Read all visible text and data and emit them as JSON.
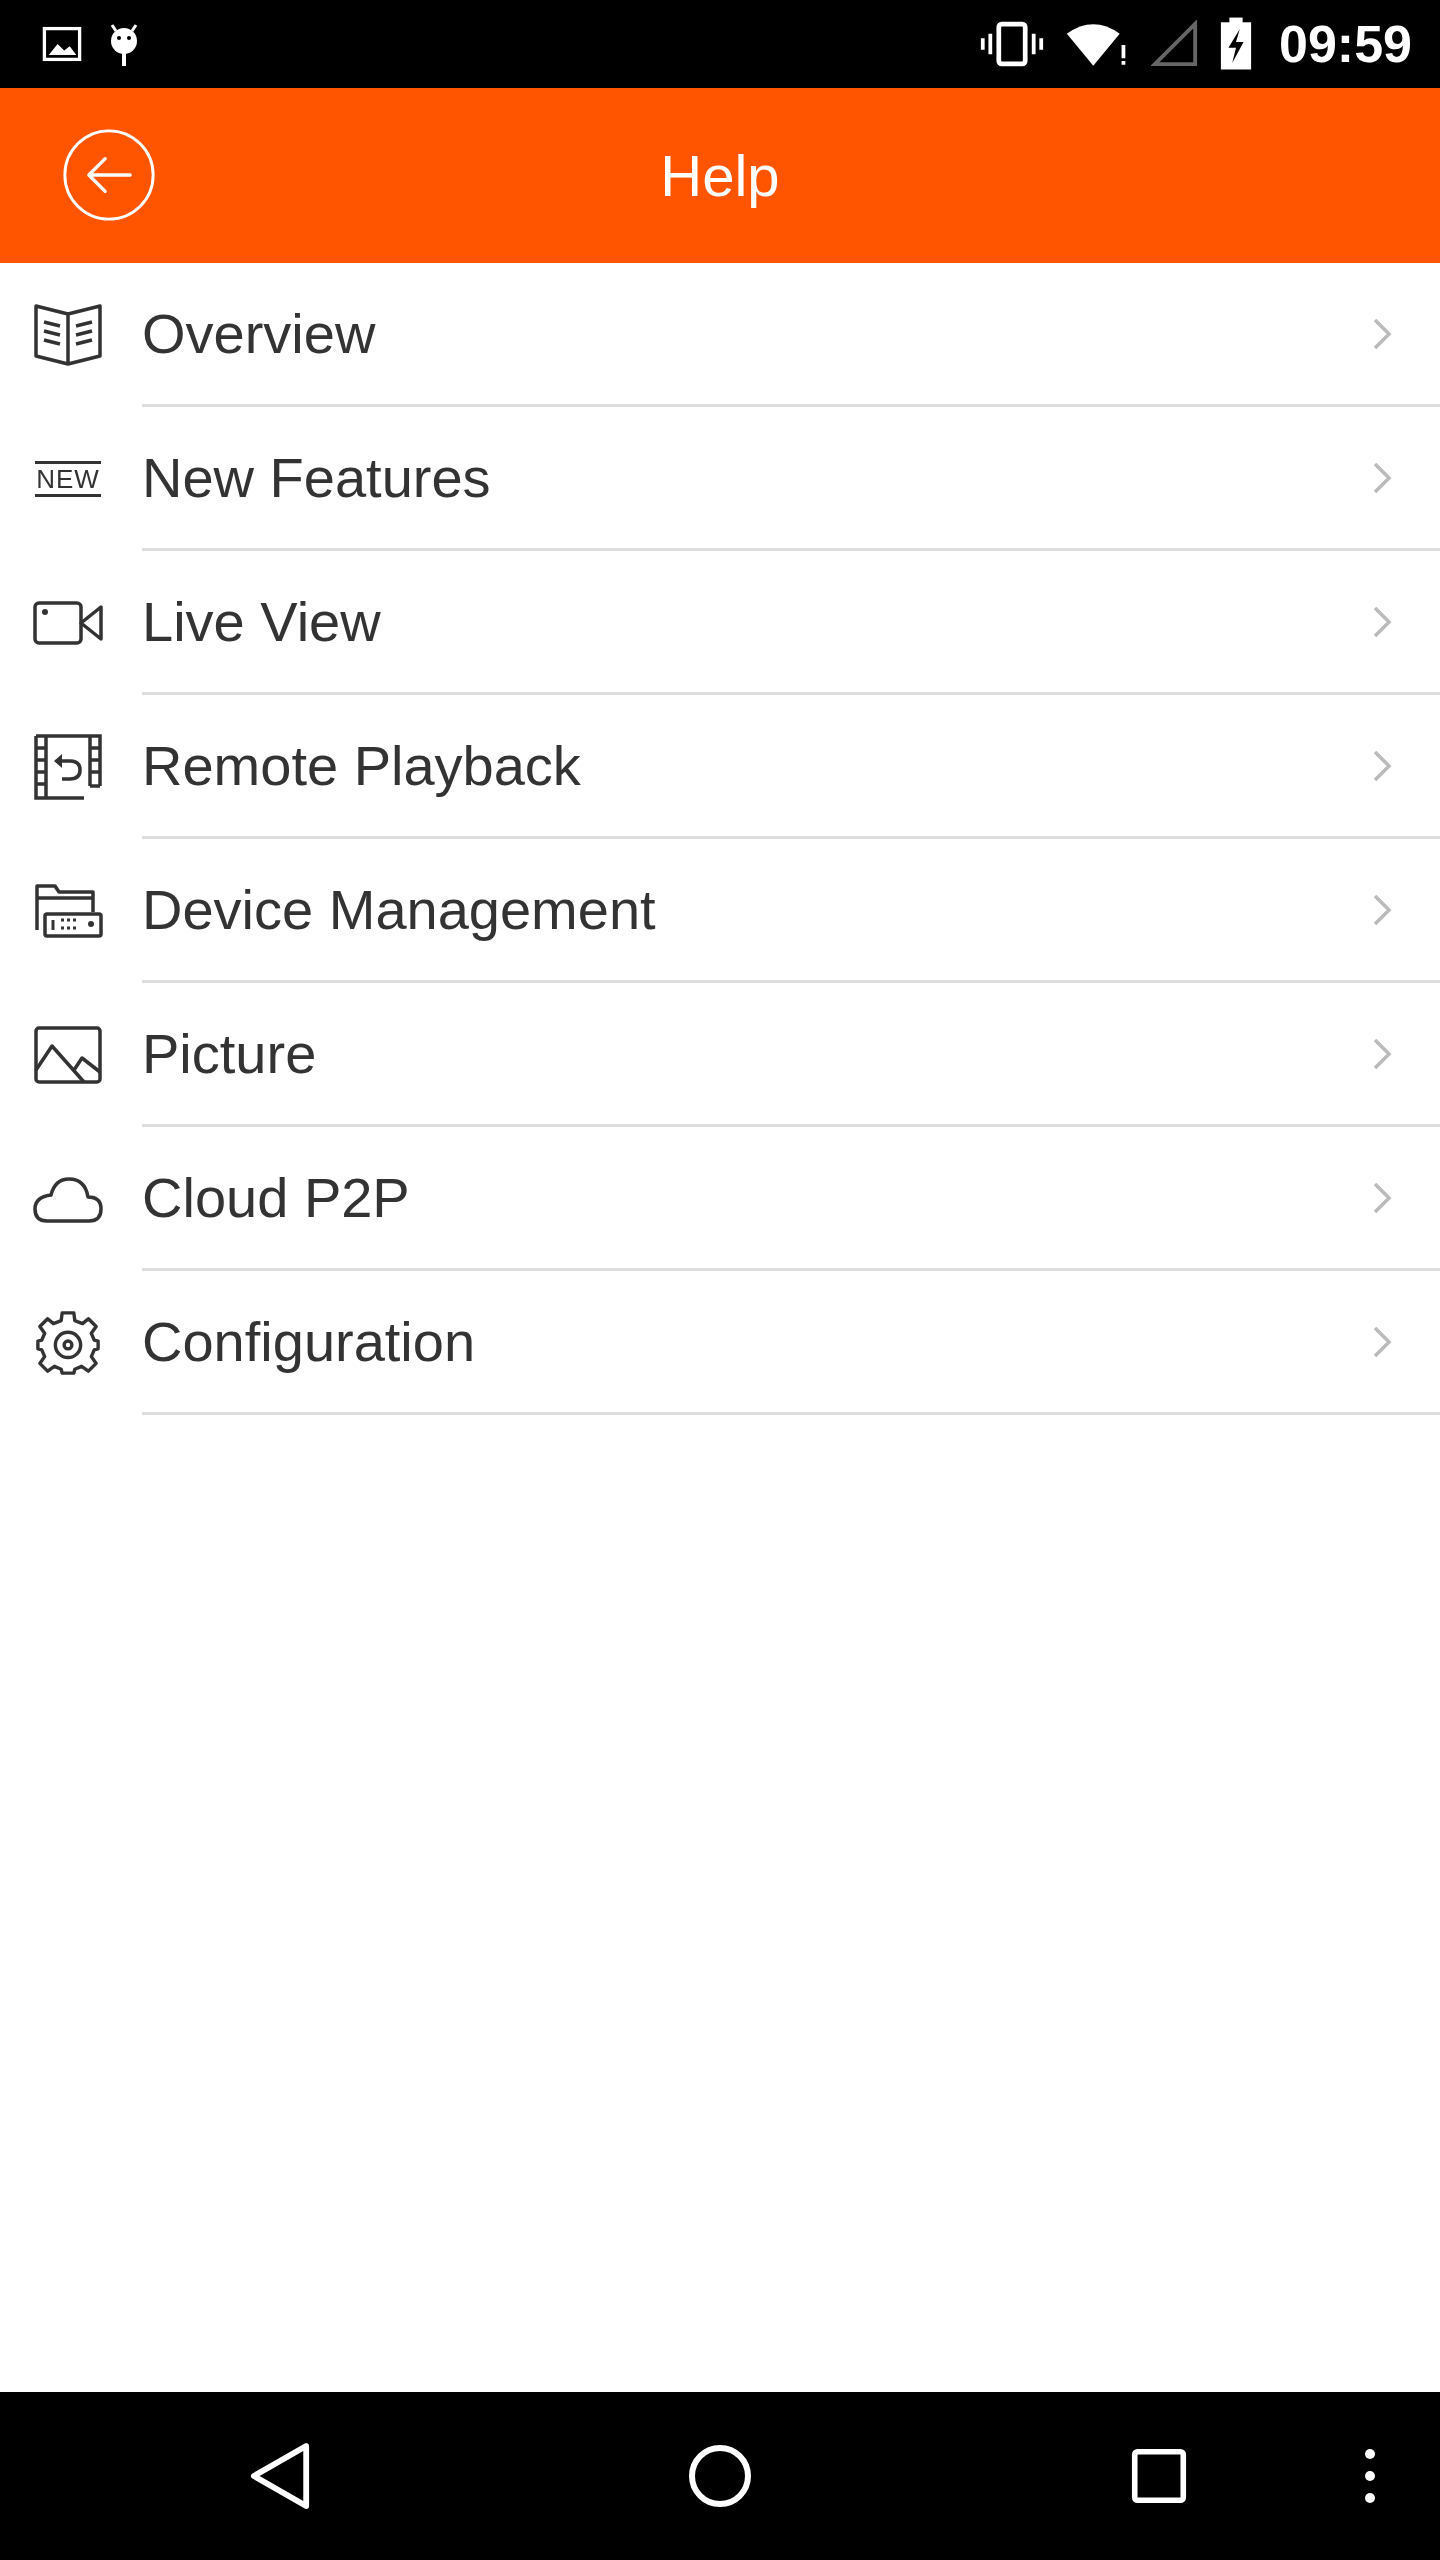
{
  "status_bar": {
    "time": "09:59"
  },
  "header": {
    "title": "Help"
  },
  "items": [
    {
      "label": "Overview",
      "kind": "book"
    },
    {
      "label": "New Features",
      "kind": "new",
      "icon_text": "NEW"
    },
    {
      "label": "Live View",
      "kind": "camera"
    },
    {
      "label": "Remote Playback",
      "kind": "playback"
    },
    {
      "label": "Device Management",
      "kind": "device"
    },
    {
      "label": "Picture",
      "kind": "picture"
    },
    {
      "label": "Cloud P2P",
      "kind": "cloud"
    },
    {
      "label": "Configuration",
      "kind": "gear"
    }
  ]
}
